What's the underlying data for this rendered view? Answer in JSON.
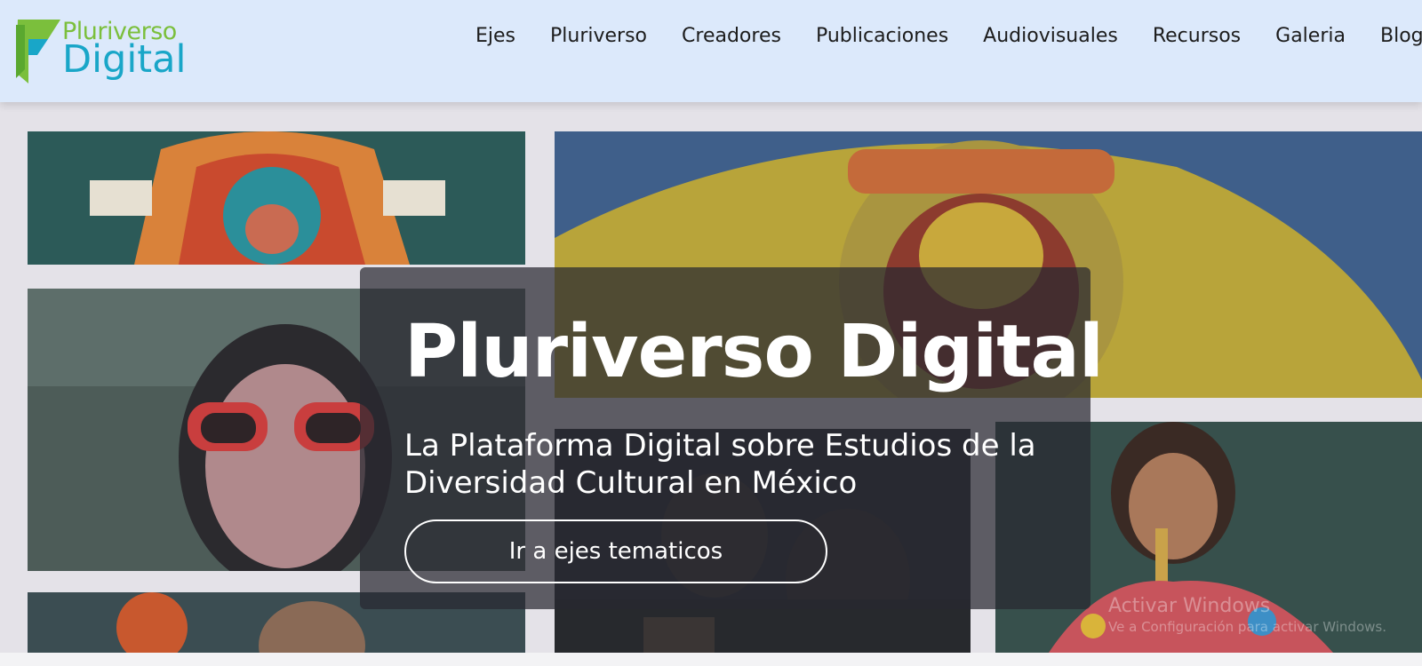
{
  "header": {
    "logo": {
      "line1": "Pluriverso",
      "line2": "Digital"
    },
    "nav": [
      "Ejes",
      "Pluriverso",
      "Creadores",
      "Publicaciones",
      "Audiovisuales",
      "Recursos",
      "Galeria",
      "Blog"
    ]
  },
  "hero": {
    "title": "Pluriverso Digital",
    "subtitle": "La Plataforma Digital sobre Estudios de la Diversidad Cultural en México",
    "button_label": "Ir a ejes tematicos"
  },
  "watermark": {
    "line1": "Activar Windows",
    "line2": "Ve a Configuración para activar Windows."
  },
  "colors": {
    "header_bg": "#dce9fb",
    "logo_green": "#7bbf3c",
    "logo_blue": "#19a6c8",
    "overlay": "#28282f"
  }
}
